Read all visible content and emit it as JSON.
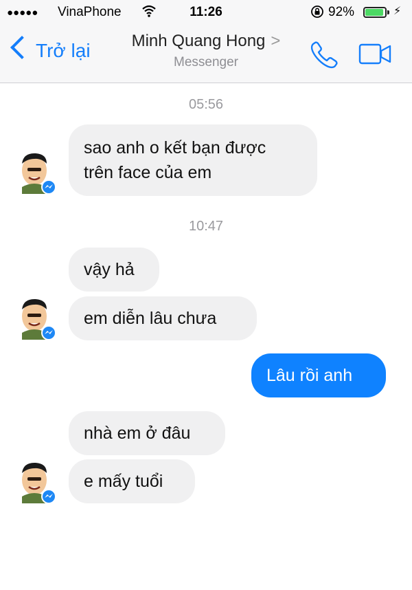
{
  "status_bar": {
    "signal_dots": "●●●●●",
    "carrier": "VinaPhone",
    "time": "11:26",
    "battery_percent": "92%",
    "battery_level": 0.92,
    "charging_symbol": "⚡"
  },
  "nav": {
    "back_label": "Trở lại",
    "contact_name": "Minh Quang Hong",
    "subtitle": "Messenger"
  },
  "chat": {
    "timestamps": [
      "05:56",
      "10:47"
    ],
    "messages": [
      {
        "direction": "incoming",
        "lines": [
          "sao anh o kết bạn được",
          "trên face của em"
        ]
      },
      {
        "direction": "incoming",
        "lines": [
          "vậy hả"
        ]
      },
      {
        "direction": "incoming",
        "lines": [
          "em diễn lâu chưa"
        ]
      },
      {
        "direction": "outgoing",
        "lines": [
          "Lâu rồi anh"
        ]
      },
      {
        "direction": "incoming",
        "lines": [
          "nhà em ở đâu"
        ]
      },
      {
        "direction": "incoming",
        "lines": [
          "e mấy tuổi"
        ]
      }
    ]
  },
  "colors": {
    "accent": "#147efb",
    "outgoing_bubble": "#0f82ff",
    "incoming_bubble": "#f0f0f1"
  }
}
